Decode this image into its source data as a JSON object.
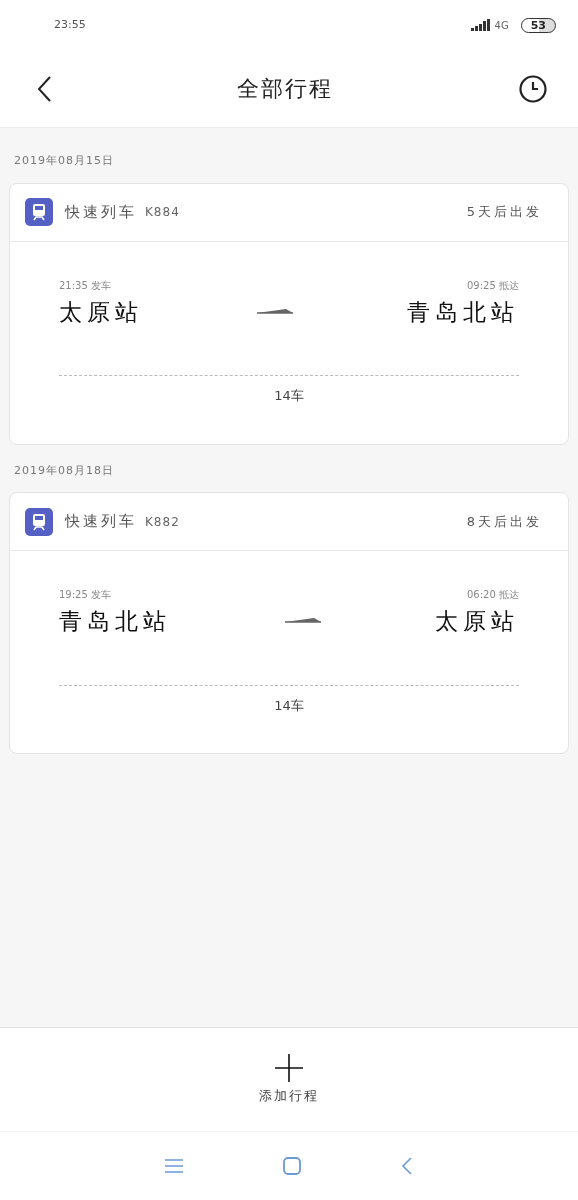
{
  "status_bar": {
    "time": "23:55",
    "network": "4G",
    "battery": "53"
  },
  "header": {
    "title": "全部行程"
  },
  "trips": [
    {
      "date": "2019年08月15日",
      "train_type": "快速列车",
      "train_no": "K884",
      "countdown": "5天后出发",
      "depart_time": "21:35 发车",
      "arrive_time": "09:25 抵达",
      "from": "太原站",
      "to": "青岛北站",
      "coach": "14车"
    },
    {
      "date": "2019年08月18日",
      "train_type": "快速列车",
      "train_no": "K882",
      "countdown": "8天后出发",
      "depart_time": "19:25 发车",
      "arrive_time": "06:20 抵达",
      "from": "青岛北站",
      "to": "太原站",
      "coach": "14车"
    }
  ],
  "add_button": {
    "label": "添加行程"
  }
}
